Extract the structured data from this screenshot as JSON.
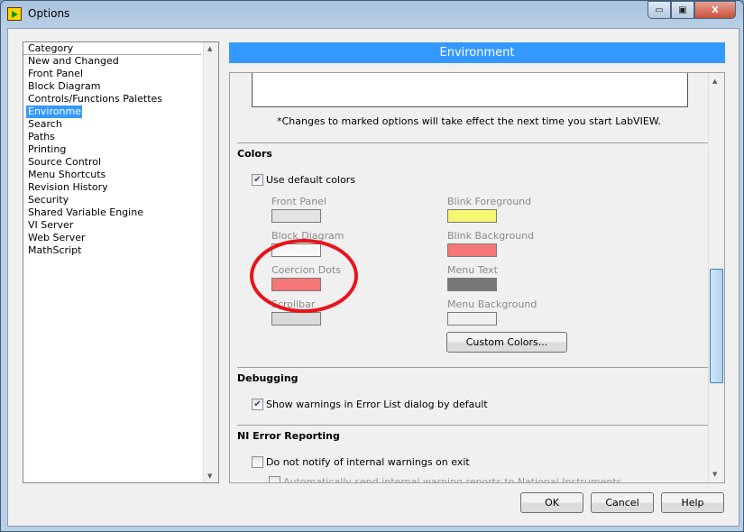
{
  "window": {
    "title": "Options",
    "minimize": "▭",
    "maximize": "▣",
    "close": "X"
  },
  "sidebar": {
    "header": "Category",
    "items": [
      "New and Changed",
      "Front Panel",
      "Block Diagram",
      "Controls/Functions Palettes",
      "Environment",
      "Search",
      "Paths",
      "Printing",
      "Source Control",
      "Menu Shortcuts",
      "Revision History",
      "Security",
      "Shared Variable Engine",
      "VI Server",
      "Web Server",
      "MathScript"
    ],
    "selected": "Environment"
  },
  "main": {
    "title": "Environment",
    "note": "*Changes to marked options will take effect the next time you start LabVIEW.",
    "colors": {
      "heading": "Colors",
      "use_default": {
        "label": "Use default colors",
        "checked": true
      },
      "swatches": [
        {
          "label": "Front Panel",
          "color": "#e3e3e3"
        },
        {
          "label": "Block Diagram",
          "color": "#f7f7f7"
        },
        {
          "label": "Coercion Dots",
          "color": "#f47676"
        },
        {
          "label": "Scrollbar",
          "color": "#dadada"
        },
        {
          "label": "Blink Foreground",
          "color": "#f6f673"
        },
        {
          "label": "Blink Background",
          "color": "#f47676"
        },
        {
          "label": "Menu Text",
          "color": "#777777"
        },
        {
          "label": "Menu Background",
          "color": "#f0f0f0"
        }
      ],
      "custom_button": "Custom Colors...",
      "annotation_color": "#e8141c"
    },
    "debugging": {
      "heading": "Debugging",
      "show_warnings": {
        "label": "Show warnings in Error List dialog by default",
        "checked": true
      }
    },
    "ni_error": {
      "heading": "NI Error Reporting",
      "do_not_notify": {
        "label": "Do not notify of internal warnings on exit",
        "checked": false
      },
      "auto_send": {
        "label": "Automatically send internal warning reports to National Instruments",
        "checked": false
      }
    }
  },
  "buttons": {
    "ok": "OK",
    "cancel": "Cancel",
    "help": "Help"
  },
  "accent": "#3399ff"
}
